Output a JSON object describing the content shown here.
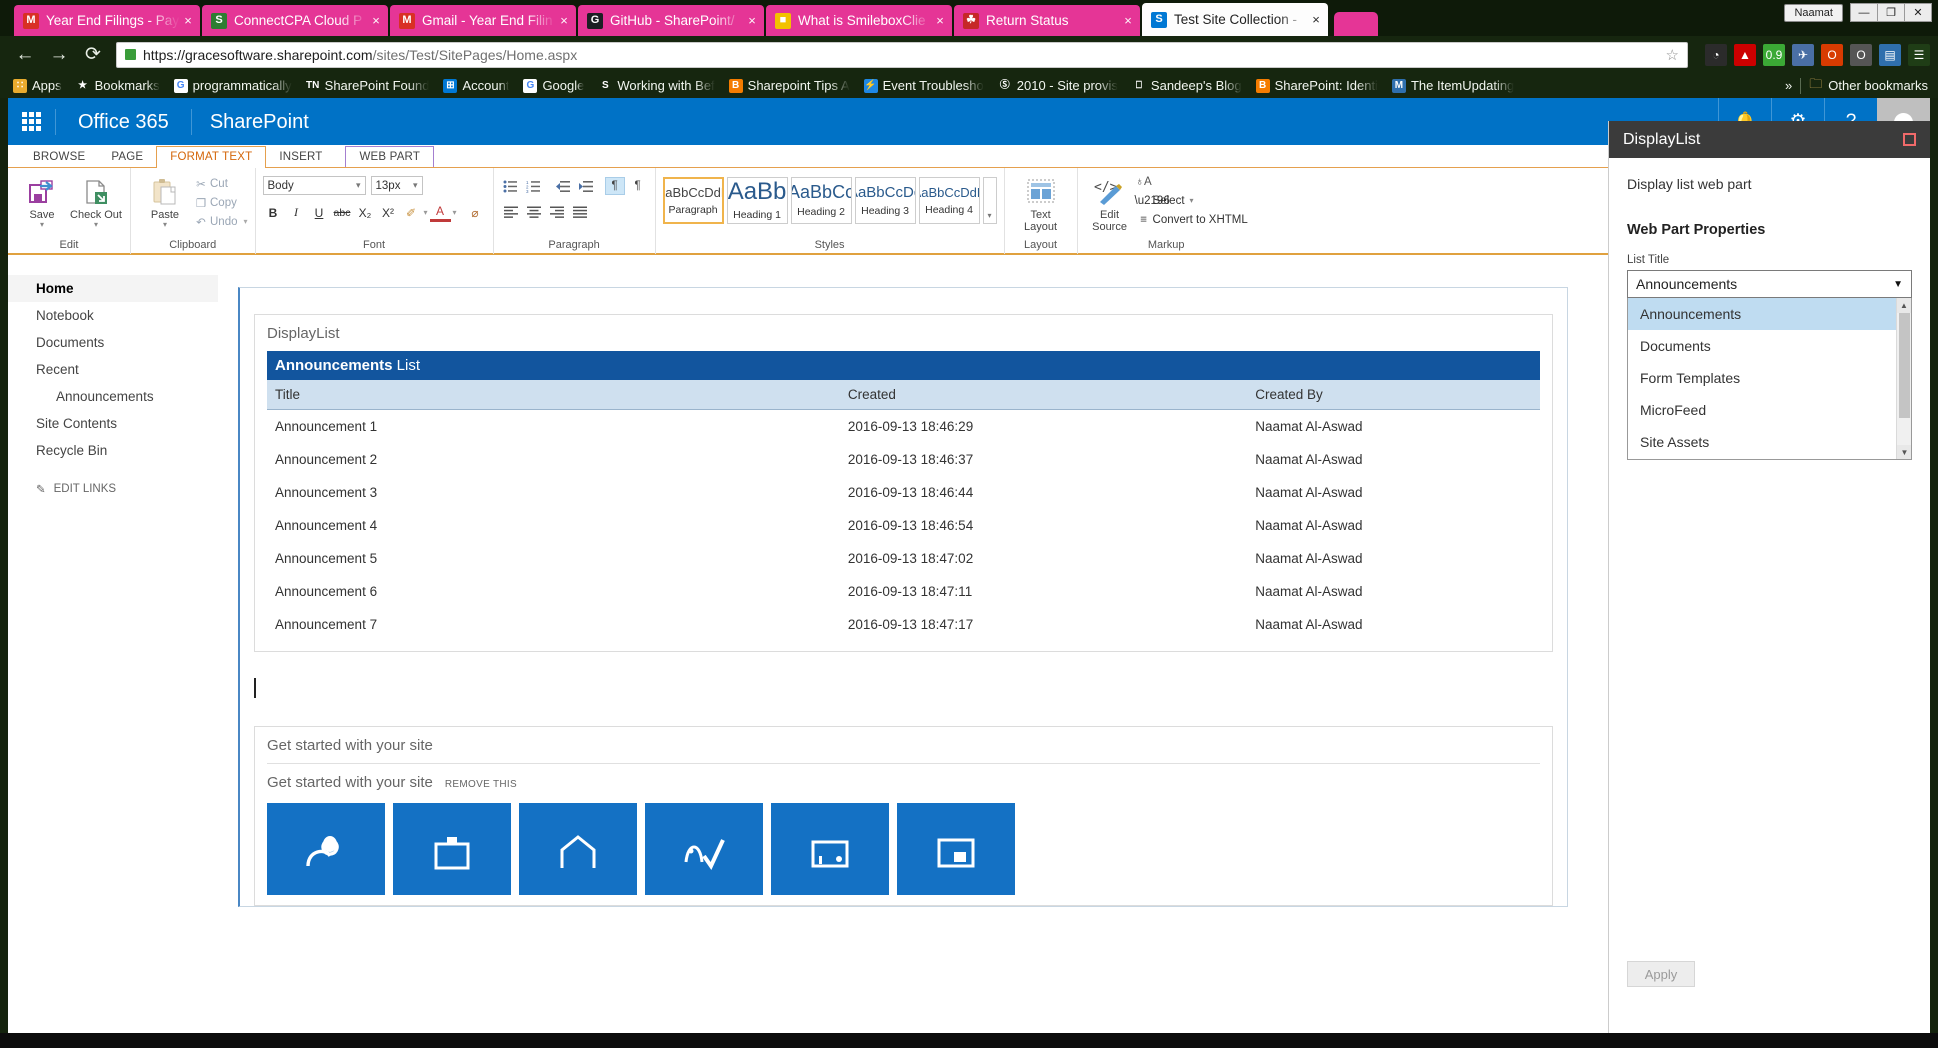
{
  "browser": {
    "tabs": [
      {
        "title": "Year End Filings - Pay",
        "favicon": "gmail-icon",
        "fav_color": "#d93025",
        "fav_text": "M",
        "active": false,
        "close_label": "×"
      },
      {
        "title": "ConnectCPA Cloud P",
        "favicon": "dollar-icon",
        "fav_color": "#2e7d32",
        "fav_text": "S",
        "active": false,
        "close_label": "×"
      },
      {
        "title": "Gmail - Year End Filin",
        "favicon": "gmail-icon",
        "fav_color": "#d93025",
        "fav_text": "M",
        "active": false,
        "close_label": "×"
      },
      {
        "title": "GitHub - SharePoint/",
        "favicon": "github-icon",
        "fav_color": "#1b1f23",
        "fav_text": "G",
        "active": false,
        "close_label": "×"
      },
      {
        "title": "What is SmileboxClie",
        "favicon": "package-icon",
        "fav_color": "#f2c200",
        "fav_text": "■",
        "active": false,
        "close_label": "×"
      },
      {
        "title": "Return Status",
        "favicon": "maple-leaf-icon",
        "fav_color": "#c62828",
        "fav_text": "☘",
        "active": false,
        "close_label": "×"
      },
      {
        "title": "Test Site Collection -",
        "favicon": "sharepoint-icon",
        "fav_color": "#0078d4",
        "fav_text": "S",
        "active": true,
        "close_label": "×"
      }
    ],
    "new_tab_label": "",
    "window_user": "Naamat",
    "window_buttons": [
      "—",
      "❐",
      "✕"
    ],
    "nav": {
      "back": "←",
      "forward": "→",
      "reload": "⟳",
      "star": "☆"
    },
    "url_domain": "https://gracesoftware.sharepoint.com",
    "url_path": "/sites/Test/SitePages/Home.aspx",
    "extensions": [
      {
        "name": "speedometer-icon",
        "color": "#2b2b2b",
        "glyph": "◔"
      },
      {
        "name": "red-hat-icon",
        "color": "#cc0000",
        "glyph": "▲"
      },
      {
        "name": "color-picker-icon",
        "color": "#3ba935",
        "glyph": "0.9"
      },
      {
        "name": "paper-plane-icon",
        "color": "#4a6fa5",
        "glyph": "✈"
      },
      {
        "name": "office-icon",
        "color": "#d83b01",
        "glyph": "O"
      },
      {
        "name": "opera-icon",
        "color": "#555555",
        "glyph": "O"
      },
      {
        "name": "browser-window-icon",
        "color": "#2f6fad",
        "glyph": "▤"
      },
      {
        "name": "chrome-menu-icon",
        "color": "#1f3d16",
        "glyph": "☰"
      }
    ],
    "bookmarks": [
      {
        "label": "Apps",
        "icon": "apps-grid-icon",
        "color": "#e8ab2e",
        "glyph": "∷"
      },
      {
        "label": "Bookmarks",
        "icon": "star-icon",
        "color": "#16260f",
        "glyph": "★"
      },
      {
        "label": "programmatically",
        "icon": "google-icon",
        "color": "#ffffff",
        "glyph": "G"
      },
      {
        "label": "SharePoint Found",
        "icon": "technet-icon",
        "color": "#16260f",
        "glyph": "TN"
      },
      {
        "label": "Account",
        "icon": "windows-icon",
        "color": "#0078d4",
        "glyph": "⊞"
      },
      {
        "label": "Google",
        "icon": "google-icon",
        "color": "#ffffff",
        "glyph": "G"
      },
      {
        "label": "Working with Bef",
        "icon": "stack-icon",
        "color": "#16260f",
        "glyph": "S"
      },
      {
        "label": "Sharepoint Tips A",
        "icon": "blogger-icon",
        "color": "#f57c00",
        "glyph": "B"
      },
      {
        "label": "Event Troublesho",
        "icon": "lightning-icon",
        "color": "#1e88e5",
        "glyph": "⚡"
      },
      {
        "label": "2010 - Site provis",
        "icon": "seal-icon",
        "color": "#16260f",
        "glyph": "Ⓢ"
      },
      {
        "label": "Sandeep's Blog",
        "icon": "page-icon",
        "color": "#16260f",
        "glyph": "⎕"
      },
      {
        "label": "SharePoint: Identi",
        "icon": "blogger-icon",
        "color": "#f57c00",
        "glyph": "B"
      },
      {
        "label": "The ItemUpdating",
        "icon": "msdn-icon",
        "color": "#2f6fad",
        "glyph": "M"
      }
    ],
    "bookmark_overflow": "»",
    "other_bookmarks": {
      "label": "Other bookmarks",
      "icon": "folder-icon",
      "glyph": "🗀"
    }
  },
  "suitebar": {
    "waffle": "app-launcher-icon",
    "o365": "Office 365",
    "brand": "SharePoint",
    "actions": [
      {
        "name": "notifications-icon",
        "glyph": "🔔"
      },
      {
        "name": "settings-gear-icon",
        "glyph": "⚙"
      },
      {
        "name": "help-icon",
        "glyph": "?"
      }
    ]
  },
  "ribbon": {
    "tabs": [
      {
        "label": "BROWSE",
        "state": "normal"
      },
      {
        "label": "PAGE",
        "state": "normal"
      },
      {
        "label": "FORMAT TEXT",
        "state": "selected"
      },
      {
        "label": "INSERT",
        "state": "normal"
      },
      {
        "label": "WEB PART",
        "state": "webpart"
      }
    ],
    "groups": {
      "edit": {
        "label": "Edit",
        "save": "Save",
        "checkout": "Check Out",
        "caret": "▾"
      },
      "clipboard": {
        "label": "Clipboard",
        "paste": "Paste",
        "cut": "Cut",
        "copy": "Copy",
        "undo": "Undo",
        "cut_icon": "✂",
        "copy_icon": "❐",
        "undo_icon": "↶"
      },
      "font": {
        "label": "Font",
        "family": "Body",
        "size": "13px",
        "bold": "B",
        "italic": "I",
        "underline": "U",
        "strike": "abc",
        "subscript": "X₂",
        "superscript": "X²",
        "highlight": "✐",
        "fontcolor": "A",
        "clear": "⌀"
      },
      "paragraph": {
        "label": "Paragraph",
        "bullets": "☰",
        "numbering": "☷",
        "outdent": "⇤",
        "indent": "⇥",
        "ltr": "¶",
        "rtl": "¶",
        "align_left": "≡",
        "align_center": "≡",
        "align_right": "≡",
        "justify": "≡"
      },
      "styles": {
        "label": "Styles",
        "items": [
          {
            "sample": "AaBbCcDdE",
            "name": "Paragraph",
            "selected": true,
            "size": 13
          },
          {
            "sample": "AaBb",
            "name": "Heading 1",
            "selected": false,
            "size": 24
          },
          {
            "sample": "AaBbCc",
            "name": "Heading 2",
            "selected": false,
            "size": 18
          },
          {
            "sample": "AaBbCcDd",
            "name": "Heading 3",
            "selected": false,
            "size": 15
          },
          {
            "sample": "AaBbCcDdE",
            "name": "Heading 4",
            "selected": false,
            "size": 13
          }
        ],
        "more": "▾"
      },
      "layout": {
        "label": "Layout",
        "text_layout": "Text\nLayout",
        "caret": "▾"
      },
      "markup": {
        "label": "Markup",
        "edit_source": "Edit\nSource",
        "select": "Select",
        "convert": "Convert to XHTML",
        "lang_icon": "♁A",
        "select_caret": "▾"
      }
    }
  },
  "leftnav": {
    "items": [
      {
        "label": "Home",
        "selected": true,
        "sub": false
      },
      {
        "label": "Notebook",
        "selected": false,
        "sub": false
      },
      {
        "label": "Documents",
        "selected": false,
        "sub": false
      },
      {
        "label": "Recent",
        "selected": false,
        "sub": false
      },
      {
        "label": "Announcements",
        "selected": false,
        "sub": true
      },
      {
        "label": "Site Contents",
        "selected": false,
        "sub": false
      },
      {
        "label": "Recycle Bin",
        "selected": false,
        "sub": false
      }
    ],
    "edit_links": "EDIT LINKS",
    "edit_links_icon": "pencil-icon"
  },
  "webpart": {
    "title": "DisplayList",
    "list_header_name": "Announcements",
    "list_header_suffix": " List",
    "columns": [
      "Title",
      "Created",
      "Created By"
    ],
    "rows": [
      {
        "title": "Announcement 1",
        "created": "2016-09-13 18:46:29",
        "created_by": "Naamat Al-Aswad"
      },
      {
        "title": "Announcement 2",
        "created": "2016-09-13 18:46:37",
        "created_by": "Naamat Al-Aswad"
      },
      {
        "title": "Announcement 3",
        "created": "2016-09-13 18:46:44",
        "created_by": "Naamat Al-Aswad"
      },
      {
        "title": "Announcement 4",
        "created": "2016-09-13 18:46:54",
        "created_by": "Naamat Al-Aswad"
      },
      {
        "title": "Announcement 5",
        "created": "2016-09-13 18:47:02",
        "created_by": "Naamat Al-Aswad"
      },
      {
        "title": "Announcement 6",
        "created": "2016-09-13 18:47:11",
        "created_by": "Naamat Al-Aswad"
      },
      {
        "title": "Announcement 7",
        "created": "2016-09-13 18:47:17",
        "created_by": "Naamat Al-Aswad"
      }
    ]
  },
  "getstarted": {
    "zone_title": "Get started with your site",
    "wp_title": "Get started with your site",
    "remove_this": "REMOVE THIS",
    "tiles": [
      {
        "name": "share-site-tile",
        "icon": "share-icon"
      },
      {
        "name": "working-on-tile",
        "icon": "briefcase-icon"
      },
      {
        "name": "site-look-tile",
        "icon": "house-icon"
      },
      {
        "name": "navigation-tile",
        "icon": "pen-check-icon"
      },
      {
        "name": "add-lists-tile",
        "icon": "window-icon"
      },
      {
        "name": "add-page-tile",
        "icon": "layout-icon"
      }
    ]
  },
  "proppane": {
    "title": "DisplayList",
    "minimize_icon": "minimize-icon",
    "description": "Display list web part",
    "section_title": "Web Part Properties",
    "field_label": "List Title",
    "selected_value": "Announcements",
    "caret": "▼",
    "options": [
      "Announcements",
      "Documents",
      "Form Templates",
      "MicroFeed",
      "Site Assets"
    ],
    "scroll_up": "▲",
    "scroll_down": "▼",
    "apply_label": "Apply"
  },
  "taskbar": {
    "clock": ""
  }
}
